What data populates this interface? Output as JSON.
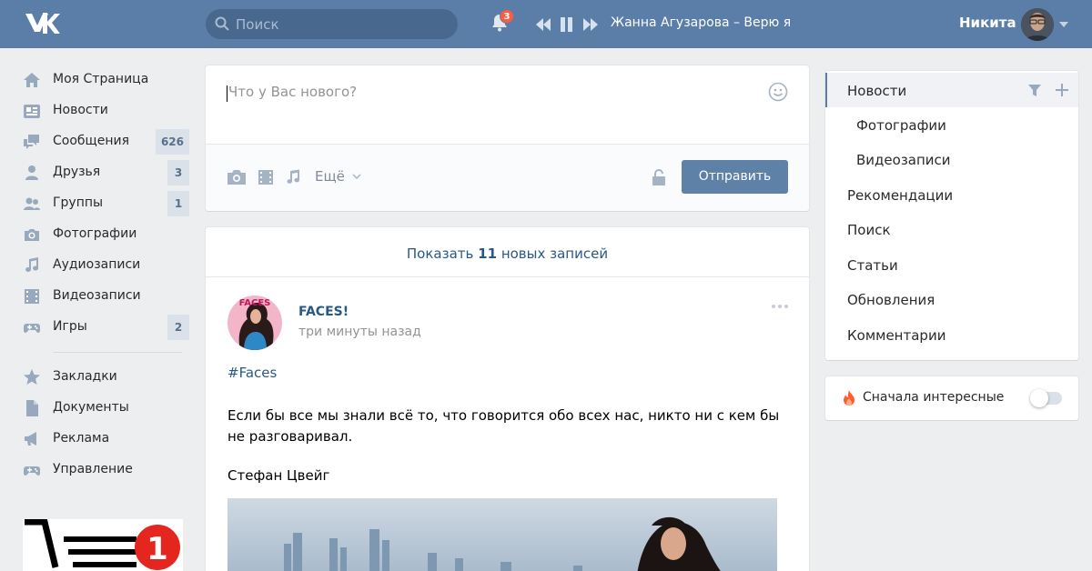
{
  "header": {
    "search_placeholder": "Поиск",
    "notifications_count": "3",
    "track": "Жанна Агузарова – Верю я",
    "user_name": "Никита"
  },
  "composer": {
    "placeholder": "Что у Вас нового?",
    "more_label": "Ещё",
    "send_label": "Отправить"
  },
  "sidebar": {
    "items": [
      {
        "label": "Моя Страница",
        "icon": "home-icon"
      },
      {
        "label": "Новости",
        "icon": "news-icon"
      },
      {
        "label": "Сообщения",
        "icon": "messages-icon",
        "count": "626"
      },
      {
        "label": "Друзья",
        "icon": "friends-icon",
        "count": "3"
      },
      {
        "label": "Группы",
        "icon": "groups-icon",
        "count": "1"
      },
      {
        "label": "Фотографии",
        "icon": "camera-icon"
      },
      {
        "label": "Аудиозаписи",
        "icon": "music-icon"
      },
      {
        "label": "Видеозаписи",
        "icon": "video-icon"
      },
      {
        "label": "Игры",
        "icon": "gamepad-icon",
        "count": "2"
      }
    ],
    "extra_items": [
      {
        "label": "Закладки",
        "icon": "star-icon"
      },
      {
        "label": "Документы",
        "icon": "document-icon"
      },
      {
        "label": "Реклама",
        "icon": "megaphone-icon"
      },
      {
        "label": "Управление",
        "icon": "gamepad-icon"
      }
    ],
    "cart_badge": "1"
  },
  "feed": {
    "show_more_prefix": "Показать",
    "show_more_count": "11",
    "show_more_suffix": "новых записей",
    "post": {
      "author": "FACES!",
      "time": "три минуты назад",
      "hashtag": "#Faces",
      "text": "Если бы все мы знали всё то, что говорится обо всех нас, никто ни с кем бы не разговаривал.",
      "signature": "Стефан Цвейг"
    }
  },
  "right_menu": {
    "items": [
      {
        "label": "Новости",
        "active": true
      },
      {
        "label": "Фотографии",
        "sub": true
      },
      {
        "label": "Видеозаписи",
        "sub": true
      },
      {
        "label": "Рекомендации"
      },
      {
        "label": "Поиск"
      },
      {
        "label": "Статьи"
      },
      {
        "label": "Обновления"
      },
      {
        "label": "Комментарии"
      }
    ],
    "toggle_label": "Сначала интересные"
  },
  "colors": {
    "header_bg": "#5b7ea8",
    "link": "#2a5885",
    "button_bg": "#5e81a8",
    "page_bg": "#edeef0"
  }
}
